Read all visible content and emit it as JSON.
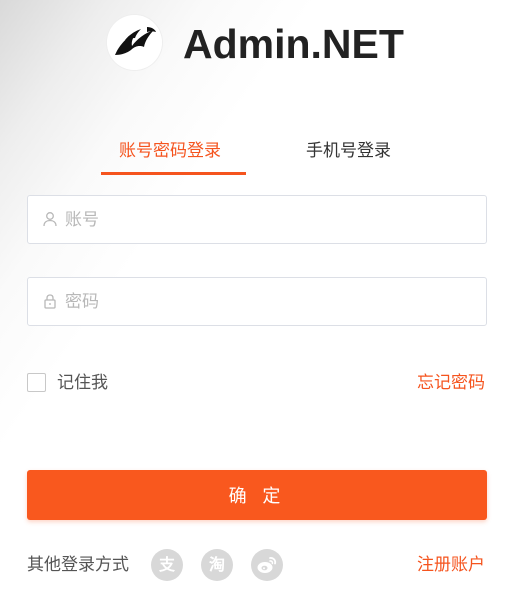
{
  "app": {
    "title": "Admin.NET",
    "logo_icon": "eagle-logo-icon"
  },
  "tabs": [
    {
      "label": "账号密码登录",
      "active": true
    },
    {
      "label": "手机号登录",
      "active": false
    }
  ],
  "form": {
    "account_placeholder": "账号",
    "account_value": "",
    "password_placeholder": "密码",
    "password_value": "",
    "remember_label": "记住我",
    "remember_checked": false,
    "forgot_label": "忘记密码",
    "submit_label": "确 定"
  },
  "footer": {
    "other_login_label": "其他登录方式",
    "social": [
      {
        "icon": "alipay-icon",
        "glyph": "支"
      },
      {
        "icon": "taobao-icon",
        "glyph": "淘"
      },
      {
        "icon": "weibo-icon",
        "glyph": ""
      }
    ],
    "register_label": "注册账户"
  },
  "colors": {
    "accent": "#f5541e",
    "button": "#f9581e",
    "title": "#222222",
    "icon_gray": "#d8d8d8"
  }
}
